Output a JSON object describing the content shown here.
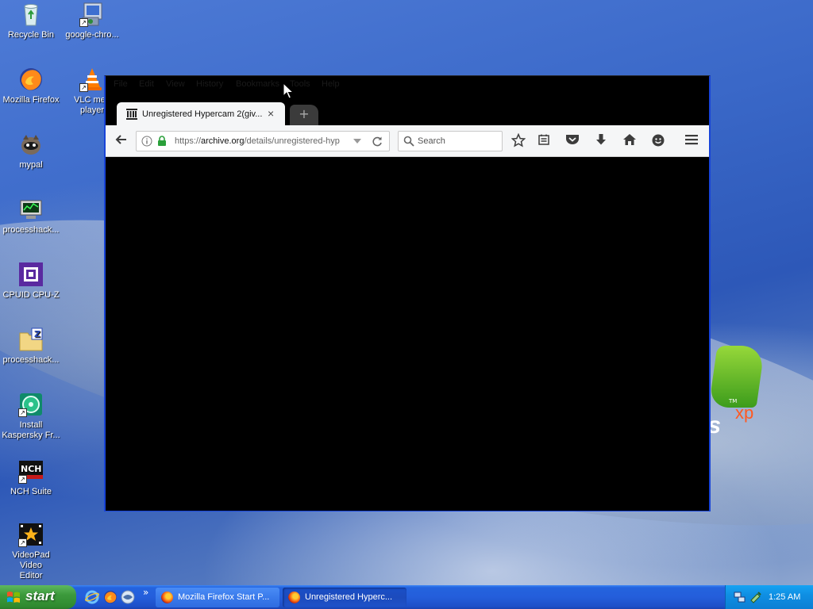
{
  "desktop": {
    "icons": [
      {
        "label": "Recycle Bin",
        "icon": "recycle-bin-icon"
      },
      {
        "label": "google-chro...",
        "icon": "installer-icon"
      },
      {
        "label": "Mozilla Firefox",
        "icon": "firefox-icon"
      },
      {
        "label": "VLC med",
        "label2": "player",
        "icon": "vlc-icon"
      },
      {
        "label": "mypal",
        "icon": "mypal-icon"
      },
      {
        "label": "processhack...",
        "icon": "processhacker-icon"
      },
      {
        "label": "CPUID CPU-Z",
        "icon": "cpuz-icon"
      },
      {
        "label": "processhack...",
        "icon": "zip-folder-icon"
      },
      {
        "label": "Install",
        "label2": "Kaspersky Fr...",
        "icon": "kaspersky-icon"
      },
      {
        "label": "NCH Suite",
        "icon": "nch-icon"
      },
      {
        "label": "VideoPad Video",
        "label2": "Editor",
        "icon": "videopad-icon"
      }
    ],
    "wallpaper_logo": {
      "text": "ws",
      "superscript": "xp",
      "tm": "TM"
    }
  },
  "browser": {
    "menu": [
      "File",
      "Edit",
      "View",
      "History",
      "Bookmarks",
      "Tools",
      "Help"
    ],
    "tab": {
      "title": "Unregistered Hypercam 2(giv...",
      "close": "×"
    },
    "newtab": "+",
    "url": {
      "prefix": "https://",
      "domain": "archive.org",
      "path": "/details/unregistered-hyp"
    },
    "search_placeholder": "Search",
    "colors": {
      "content": "#000000",
      "frame": "#1844d8"
    }
  },
  "taskbar": {
    "start_label": "start",
    "chevron": "»",
    "tasks": [
      {
        "label": "Mozilla Firefox Start P..."
      },
      {
        "label": "Unregistered Hyperc..."
      }
    ],
    "clock": "1:25 AM"
  }
}
